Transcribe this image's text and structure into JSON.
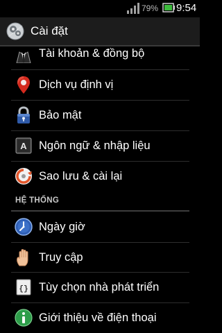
{
  "status_bar": {
    "battery_percent": "79%",
    "time": "9:54",
    "signal_icon": "signal-bars-icon",
    "battery_icon": "battery-icon"
  },
  "action_bar": {
    "title": "Cài đặt",
    "icon": "settings-app-icon"
  },
  "items": [
    {
      "label": "Tài khoản & đồng bộ",
      "icon": "account-sync-icon"
    },
    {
      "label": "Dịch vụ định vị",
      "icon": "location-pin-icon"
    },
    {
      "label": "Bảo mật",
      "icon": "lock-icon"
    },
    {
      "label": "Ngôn ngữ & nhập liệu",
      "icon": "language-keyboard-icon"
    },
    {
      "label": "Sao lưu & cài lại",
      "icon": "backup-restore-icon"
    }
  ],
  "section": {
    "header": "HỆ THỐNG"
  },
  "system_items": [
    {
      "label": "Ngày giờ",
      "icon": "clock-icon"
    },
    {
      "label": "Truy cập",
      "icon": "hand-icon"
    },
    {
      "label": "Tùy chọn nhà phát triển",
      "icon": "developer-braces-icon"
    },
    {
      "label": "Giới thiệu về điện thoại",
      "icon": "info-icon"
    }
  ],
  "colors": {
    "background": "#000000",
    "action_bar": "#1c1c1c",
    "divider": "#2e2e2e",
    "battery_green": "#3dbb3d"
  }
}
